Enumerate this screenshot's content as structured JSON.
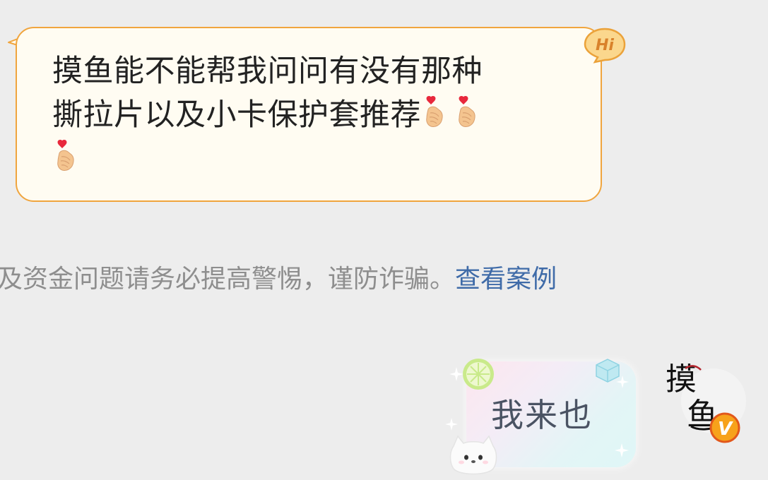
{
  "incoming_message": {
    "text_line1": "摸鱼能不能帮我问问有没有那种",
    "text_line2": "撕拉片以及小卡保护套推荐",
    "emojis": [
      "finger-heart-icon",
      "finger-heart-icon",
      "finger-heart-icon"
    ],
    "badge_label": "Hi"
  },
  "system_notice": {
    "text": "及资金问题请务必提高警惕，谨防诈骗。",
    "link_label": "查看案例"
  },
  "outgoing_message": {
    "text": "我来也"
  },
  "avatar": {
    "label": "摸鱼",
    "badge": "V"
  },
  "colors": {
    "background": "#ededed",
    "incoming_bubble_fill": "#fffcf2",
    "incoming_bubble_border": "#f0a53e",
    "link": "#3f6ba8",
    "notice_text": "#8e8e8e",
    "outgoing_text": "#4a5363",
    "avatar_badge": "#f5a623"
  }
}
